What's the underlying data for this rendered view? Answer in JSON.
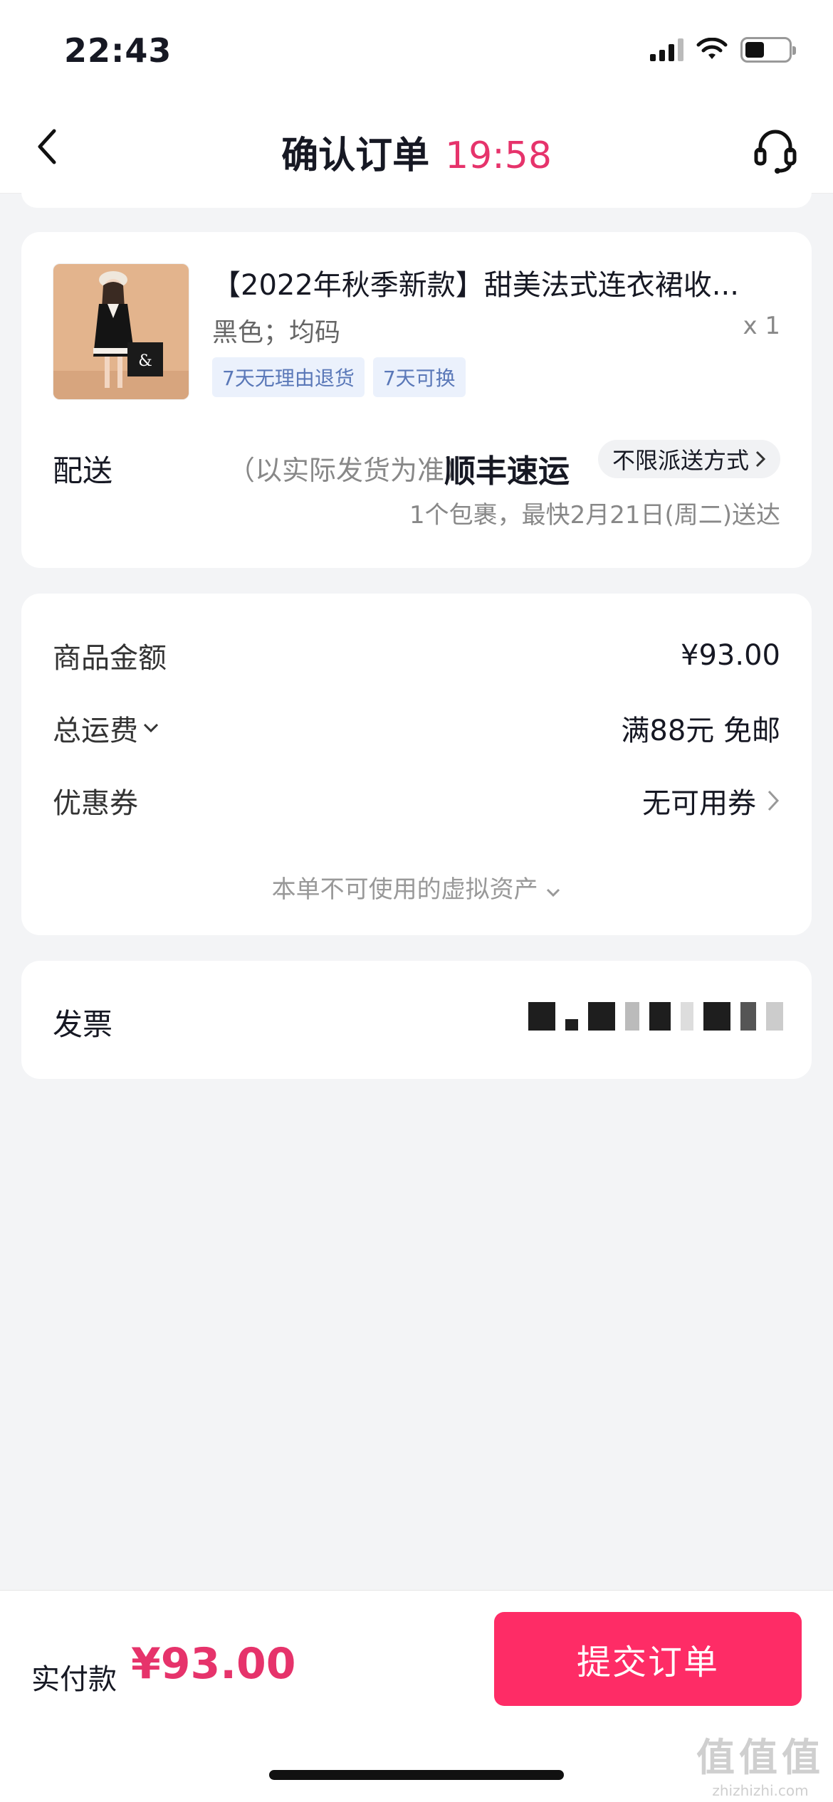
{
  "status_bar": {
    "time": "22:43"
  },
  "header": {
    "title": "确认订单",
    "timer": "19:58"
  },
  "product": {
    "title": "【2022年秋季新款】甜美法式连衣裙收...",
    "spec": "黑色；均码",
    "quantity": "x 1",
    "tags": [
      "7天无理由退货",
      "7天可换"
    ]
  },
  "shipping": {
    "label": "配送",
    "note": "（以实际发货为准）",
    "carrier": "顺丰速运",
    "option": "不限派送方式",
    "eta": "1个包裹，最快2月21日(周二)送达"
  },
  "price": {
    "goods_label": "商品金额",
    "goods_value": "¥93.00",
    "freight_label": "总运费",
    "freight_value": "满88元 免邮",
    "coupon_label": "优惠券",
    "coupon_value": "无可用券",
    "virtual_assets": "本单不可使用的虚拟资产"
  },
  "invoice": {
    "label": "发票"
  },
  "footer": {
    "pay_label": "实付款",
    "pay_amount": "¥93.00",
    "submit": "提交订单",
    "watermark": "值值值",
    "watermark_url": "zhizhizhi.com"
  },
  "colors": {
    "accent": "#e6336b",
    "button": "#fe2c66",
    "tag_bg": "#ebf1fc",
    "tag_text": "#5a78b8"
  }
}
